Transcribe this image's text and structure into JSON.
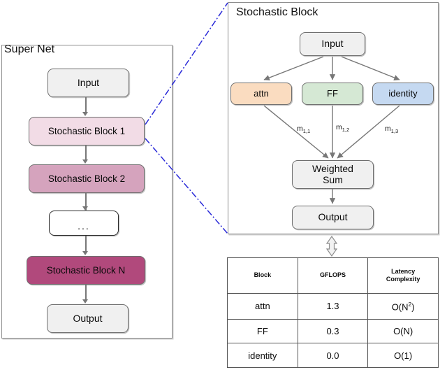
{
  "supernet": {
    "title": "Super Net",
    "nodes": [
      {
        "label": "Input",
        "kind": "plain",
        "color": "#f0f0f0"
      },
      {
        "label": "Stochastic Block 1",
        "kind": "block1",
        "color": "#f2dce6"
      },
      {
        "label": "Stochastic Block 2",
        "kind": "block2",
        "color": "#d5a3bd"
      },
      {
        "label": "...",
        "kind": "ellipsis",
        "color": "#ffffff"
      },
      {
        "label": "Stochastic Block N",
        "kind": "blockn",
        "color": "#b1497c"
      },
      {
        "label": "Output",
        "kind": "plain",
        "color": "#f0f0f0"
      }
    ]
  },
  "stochastic_block": {
    "title": "Stochastic Block",
    "input": {
      "label": "Input",
      "color": "#f0f0f0"
    },
    "options": [
      {
        "label": "attn",
        "color": "#fadcc0"
      },
      {
        "label": "FF",
        "color": "#d5e8d4"
      },
      {
        "label": "identity",
        "color": "#c5d9f1"
      }
    ],
    "weights": [
      {
        "base": "m",
        "sub": "1,1"
      },
      {
        "base": "m",
        "sub": "1,2"
      },
      {
        "base": "m",
        "sub": "1,3"
      }
    ],
    "weighted_sum": {
      "line1": "Weighted",
      "line2": "Sum",
      "color": "#f0f0f0"
    },
    "output": {
      "label": "Output",
      "color": "#f0f0f0"
    }
  },
  "cost_table": {
    "headers": [
      "Block",
      "GFLOPS",
      "Latency\nComplexity"
    ],
    "header_latency_line1": "Latency",
    "header_latency_line2": "Complexity",
    "rows": [
      {
        "block": "attn",
        "gflops": "1.3",
        "latency_base": "O(N",
        "latency_sup": "2",
        "latency_tail": ")"
      },
      {
        "block": "FF",
        "gflops": "0.3",
        "latency_base": "O(N)",
        "latency_sup": "",
        "latency_tail": ""
      },
      {
        "block": "identity",
        "gflops": "0.0",
        "latency_base": "O(1)",
        "latency_sup": "",
        "latency_tail": ""
      }
    ]
  },
  "connectors": {
    "zoom_line_color": "#2a2ad8",
    "double_arrow_name": "vertical-double-arrow"
  }
}
